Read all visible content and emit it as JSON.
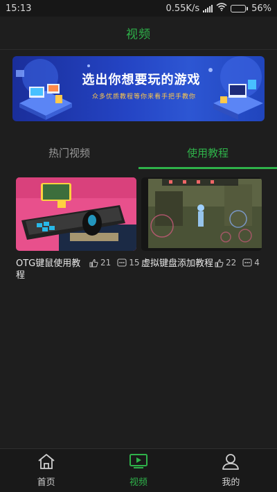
{
  "status_bar": {
    "time": "15:13",
    "network_speed": "0.55K/s",
    "battery_percent": "56%",
    "battery_level": 0.56
  },
  "header": {
    "title": "视频"
  },
  "banner": {
    "headline": "选出你想要玩的游戏",
    "subtitle": "众多优质教程等你来看手把手教你"
  },
  "tabs": [
    {
      "label": "热门视频",
      "active": false
    },
    {
      "label": "使用教程",
      "active": true
    }
  ],
  "videos": [
    {
      "title": "OTG键鼠使用教程",
      "likes": "21",
      "comments": "15"
    },
    {
      "title": "虚拟键盘添加教程",
      "likes": "22",
      "comments": "4"
    }
  ],
  "bottom_nav": [
    {
      "label": "首页",
      "icon": "home-icon",
      "active": false
    },
    {
      "label": "视频",
      "icon": "tv-play-icon",
      "active": true
    },
    {
      "label": "我的",
      "icon": "user-icon",
      "active": false
    }
  ],
  "colors": {
    "accent": "#2fb24a",
    "background": "#1e1e1e"
  }
}
